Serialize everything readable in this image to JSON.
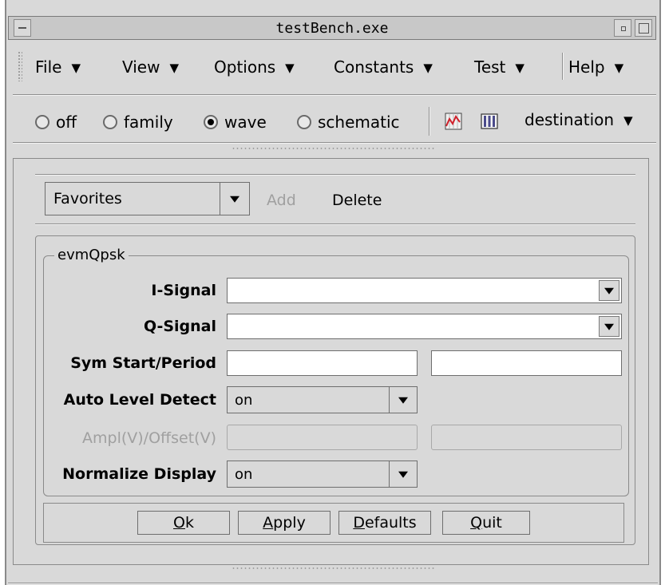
{
  "window": {
    "title": "testBench.exe"
  },
  "menubar": {
    "items": [
      {
        "label": "File"
      },
      {
        "label": "View"
      },
      {
        "label": "Options"
      },
      {
        "label": "Constants"
      },
      {
        "label": "Test"
      },
      {
        "label": "Help"
      }
    ]
  },
  "toolbar": {
    "radios": [
      {
        "label": "off",
        "selected": false
      },
      {
        "label": "family",
        "selected": false
      },
      {
        "label": "wave",
        "selected": true
      },
      {
        "label": "schematic",
        "selected": false
      }
    ],
    "icons": [
      "wave-plot-icon",
      "table-icon"
    ],
    "destination_label": "destination"
  },
  "favorites": {
    "selected": "Favorites",
    "add_label": "Add",
    "delete_label": "Delete"
  },
  "form": {
    "group_title": "evmQpsk",
    "i_signal_label": "I-Signal",
    "q_signal_label": "Q-Signal",
    "sym_label": "Sym Start/Period",
    "auto_level_label": "Auto Level Detect",
    "auto_level_value": "on",
    "ampl_label": "Ampl(V)/Offset(V)",
    "normalize_label": "Normalize Display",
    "normalize_value": "on"
  },
  "buttons": {
    "ok_u": "O",
    "ok_rest": "k",
    "apply_u": "A",
    "apply_rest": "pply",
    "defaults_u": "D",
    "defaults_rest": "efaults",
    "quit_u": "Q",
    "quit_rest": "uit"
  },
  "colors": {
    "window_bg": "#d9d9d9",
    "field_bg": "#ffffff",
    "disabled_text": "#a0a0a0"
  }
}
